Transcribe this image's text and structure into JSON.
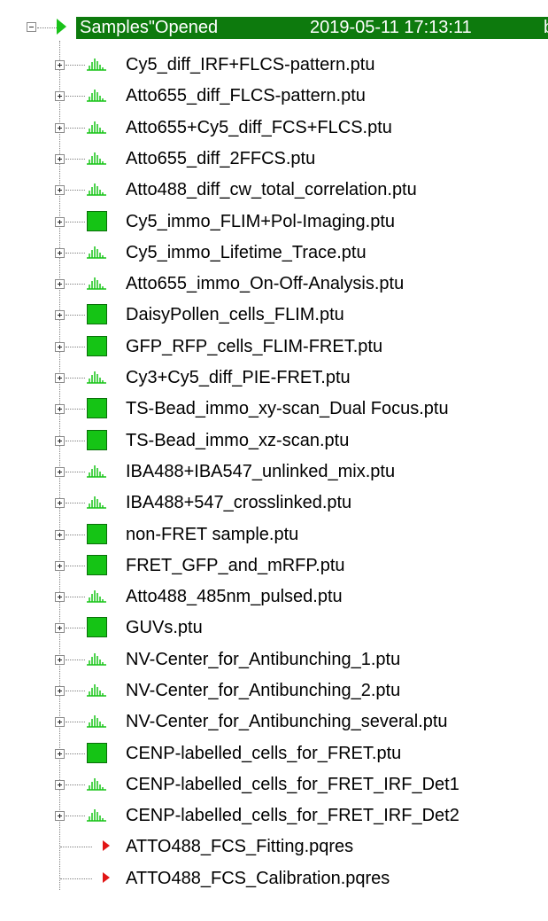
{
  "tree": {
    "root": {
      "label": "Samples\"Opened",
      "date": "2019-05-11 17:13:11",
      "trail": "b"
    },
    "items": [
      {
        "label": "Cy5_diff_IRF+FLCS-pattern.ptu",
        "icon": "graph"
      },
      {
        "label": "Atto655_diff_FLCS-pattern.ptu",
        "icon": "graph"
      },
      {
        "label": "Atto655+Cy5_diff_FCS+FLCS.ptu",
        "icon": "graph"
      },
      {
        "label": "Atto655_diff_2FFCS.ptu",
        "icon": "graph"
      },
      {
        "label": "Atto488_diff_cw_total_correlation.ptu",
        "icon": "graph"
      },
      {
        "label": "Cy5_immo_FLIM+Pol-Imaging.ptu",
        "icon": "square"
      },
      {
        "label": "Cy5_immo_Lifetime_Trace.ptu",
        "icon": "graph"
      },
      {
        "label": "Atto655_immo_On-Off-Analysis.ptu",
        "icon": "graph"
      },
      {
        "label": "DaisyPollen_cells_FLIM.ptu",
        "icon": "square"
      },
      {
        "label": "GFP_RFP_cells_FLIM-FRET.ptu",
        "icon": "square"
      },
      {
        "label": "Cy3+Cy5_diff_PIE-FRET.ptu",
        "icon": "graph"
      },
      {
        "label": "TS-Bead_immo_xy-scan_Dual Focus.ptu",
        "icon": "square"
      },
      {
        "label": "TS-Bead_immo_xz-scan.ptu",
        "icon": "square"
      },
      {
        "label": "IBA488+IBA547_unlinked_mix.ptu",
        "icon": "graph"
      },
      {
        "label": "IBA488+547_crosslinked.ptu",
        "icon": "graph"
      },
      {
        "label": "non-FRET sample.ptu",
        "icon": "square"
      },
      {
        "label": "FRET_GFP_and_mRFP.ptu",
        "icon": "square"
      },
      {
        "label": "Atto488_485nm_pulsed.ptu",
        "icon": "graph"
      },
      {
        "label": "GUVs.ptu",
        "icon": "square"
      },
      {
        "label": "NV-Center_for_Antibunching_1.ptu",
        "icon": "graph"
      },
      {
        "label": "NV-Center_for_Antibunching_2.ptu",
        "icon": "graph"
      },
      {
        "label": "NV-Center_for_Antibunching_several.ptu",
        "icon": "graph"
      },
      {
        "label": "CENP-labelled_cells_for_FRET.ptu",
        "icon": "square"
      },
      {
        "label": "CENP-labelled_cells_for_FRET_IRF_Det1",
        "icon": "graph"
      },
      {
        "label": "CENP-labelled_cells_for_FRET_IRF_Det2",
        "icon": "graph"
      },
      {
        "label": "ATTO488_FCS_Fitting.pqres",
        "icon": "play"
      },
      {
        "label": "ATTO488_FCS_Calibration.pqres",
        "icon": "play"
      }
    ],
    "colors": {
      "selection": "#0d7a0d",
      "icon_green": "#15c415",
      "icon_red": "#e11515"
    }
  }
}
